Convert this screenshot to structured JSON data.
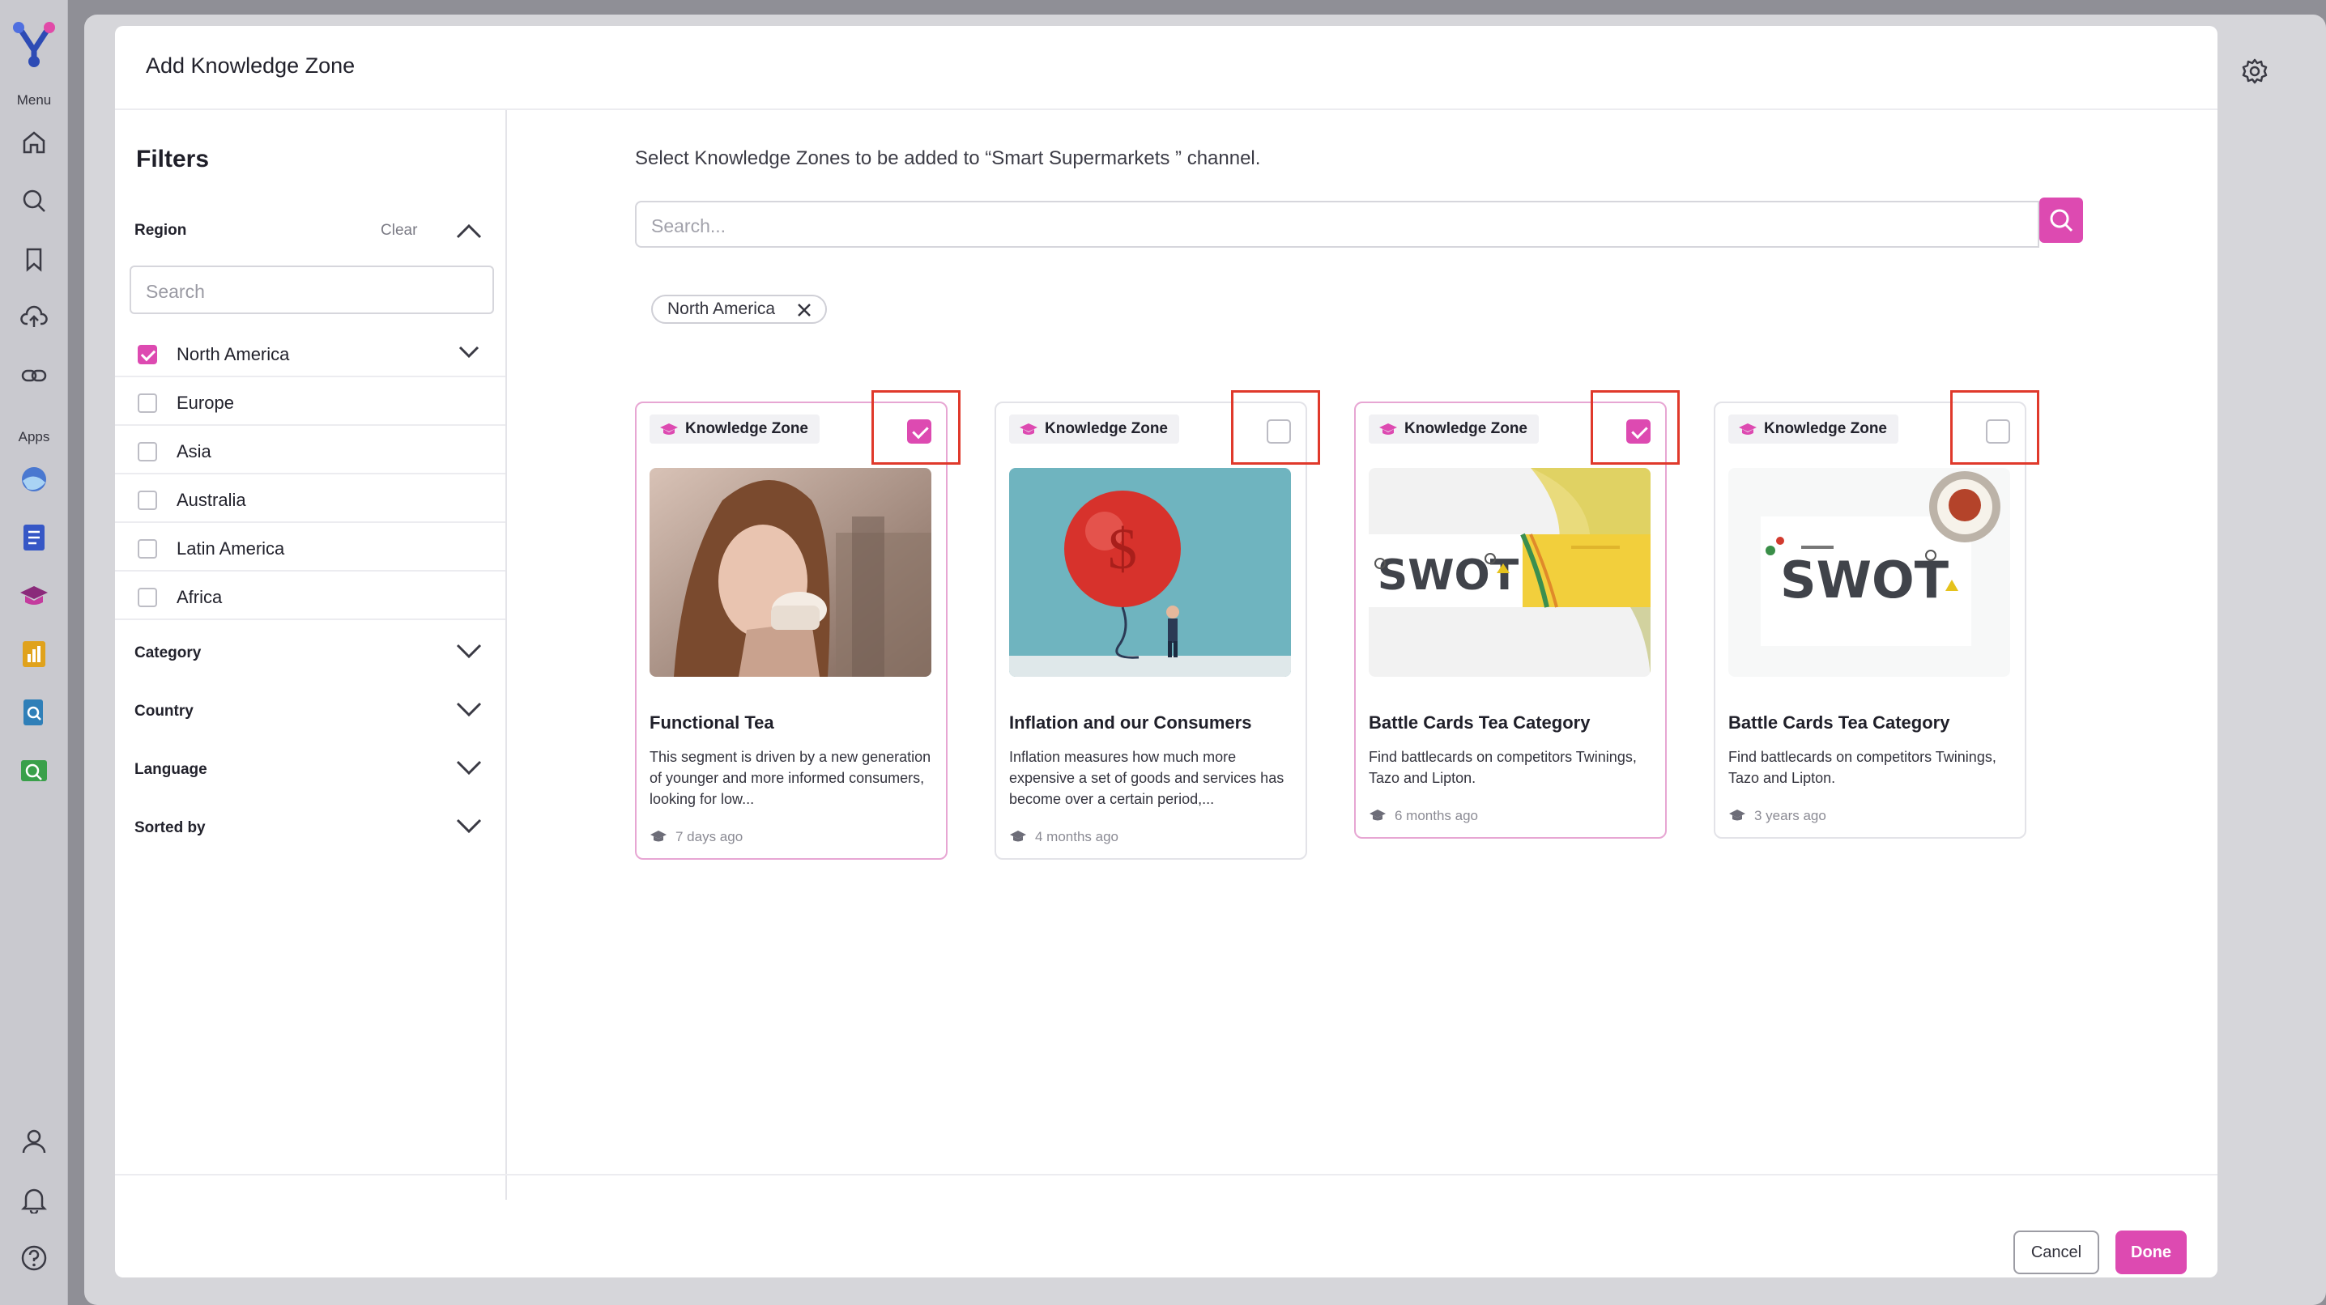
{
  "rail": {
    "menu_label": "Menu",
    "apps_label": "Apps",
    "icons": [
      "logo-icon",
      "home-icon",
      "search-icon",
      "bookmark-icon",
      "upload-icon",
      "link-icon",
      "app-moon-icon",
      "app-document-icon",
      "app-knowledge-zone-icon",
      "app-chart-icon",
      "app-file-search-icon",
      "app-image-search-icon",
      "profile-icon",
      "bell-icon",
      "help-icon"
    ]
  },
  "modal": {
    "title": "Add Knowledge Zone"
  },
  "filters": {
    "title": "Filters",
    "region": {
      "label": "Region",
      "clear_label": "Clear",
      "search_placeholder": "Search",
      "options": [
        {
          "label": "North America",
          "checked": true
        },
        {
          "label": "Europe",
          "checked": false
        },
        {
          "label": "Asia",
          "checked": false
        },
        {
          "label": "Australia",
          "checked": false
        },
        {
          "label": "Latin America",
          "checked": false
        },
        {
          "label": "Africa",
          "checked": false
        }
      ]
    },
    "sections": [
      {
        "label": "Category"
      },
      {
        "label": "Country"
      },
      {
        "label": "Language"
      },
      {
        "label": "Sorted by"
      }
    ]
  },
  "main": {
    "intro": "Select Knowledge Zones to be added to “Smart Supermarkets ” channel.",
    "search_placeholder": "Search...",
    "active_chip": "North America",
    "cards": [
      {
        "tag": "Knowledge Zone",
        "title": "Functional Tea",
        "description": "This segment is driven by a new generation of younger and more informed consumers, looking for low...",
        "meta": "7 days ago",
        "selected": true
      },
      {
        "tag": "Knowledge Zone",
        "title": "Inflation and our Consumers",
        "description": "Inflation measures how much more expensive a set of goods and services has become over a certain period,...",
        "meta": "4 months ago",
        "selected": false
      },
      {
        "tag": "Knowledge Zone",
        "title": "Battle Cards Tea Category",
        "description": "Find battlecards on competitors Twinings, Tazo and Lipton.",
        "meta": "6 months ago",
        "selected": true,
        "image_text": "SWOT"
      },
      {
        "tag": "Knowledge Zone",
        "title": "Battle Cards Tea Category",
        "description": "Find battlecards on competitors Twinings, Tazo and Lipton.",
        "meta": "3 years ago",
        "selected": false,
        "image_text": "SWOT"
      }
    ]
  },
  "footer": {
    "cancel_label": "Cancel",
    "done_label": "Done"
  },
  "colors": {
    "accent": "#dd4ab1",
    "annotation_red": "#e0392b"
  }
}
